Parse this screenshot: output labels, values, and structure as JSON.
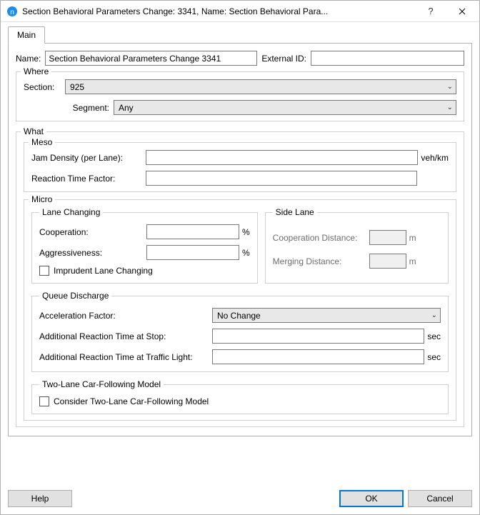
{
  "window": {
    "title": "Section Behavioral Parameters Change: 3341, Name: Section Behavioral Para..."
  },
  "tabs": {
    "main": "Main"
  },
  "name": {
    "label": "Name:",
    "value": "Section Behavioral Parameters Change 3341"
  },
  "external_id": {
    "label": "External ID:",
    "value": ""
  },
  "where": {
    "legend": "Where",
    "section_label": "Section:",
    "section_value": "925",
    "segment_label": "Segment:",
    "segment_value": "Any"
  },
  "what": {
    "legend": "What",
    "meso": {
      "legend": "Meso",
      "jam_label": "Jam Density (per Lane):",
      "jam_value": "",
      "jam_unit": "veh/km",
      "rtf_label": "Reaction Time Factor:",
      "rtf_value": ""
    },
    "micro": {
      "legend": "Micro",
      "lane": {
        "legend": "Lane Changing",
        "coop_label": "Cooperation:",
        "coop_value": "",
        "aggr_label": "Aggressiveness:",
        "aggr_value": "",
        "pct": "%",
        "imprudent_label": "Imprudent Lane Changing"
      },
      "side": {
        "legend": "Side Lane",
        "coop_dist_label": "Cooperation Distance:",
        "merge_dist_label": "Merging Distance:",
        "unit_m": "m"
      },
      "queue": {
        "legend": "Queue Discharge",
        "accel_label": "Acceleration Factor:",
        "accel_value": "No Change",
        "art_stop_label": "Additional Reaction Time at Stop:",
        "art_stop_value": "",
        "art_tl_label": "Additional Reaction Time at Traffic Light:",
        "art_tl_value": "",
        "sec": "sec"
      },
      "twolane": {
        "legend": "Two-Lane Car-Following Model",
        "chk_label": "Consider Two-Lane Car-Following Model"
      }
    }
  },
  "buttons": {
    "help": "Help",
    "ok": "OK",
    "cancel": "Cancel"
  }
}
